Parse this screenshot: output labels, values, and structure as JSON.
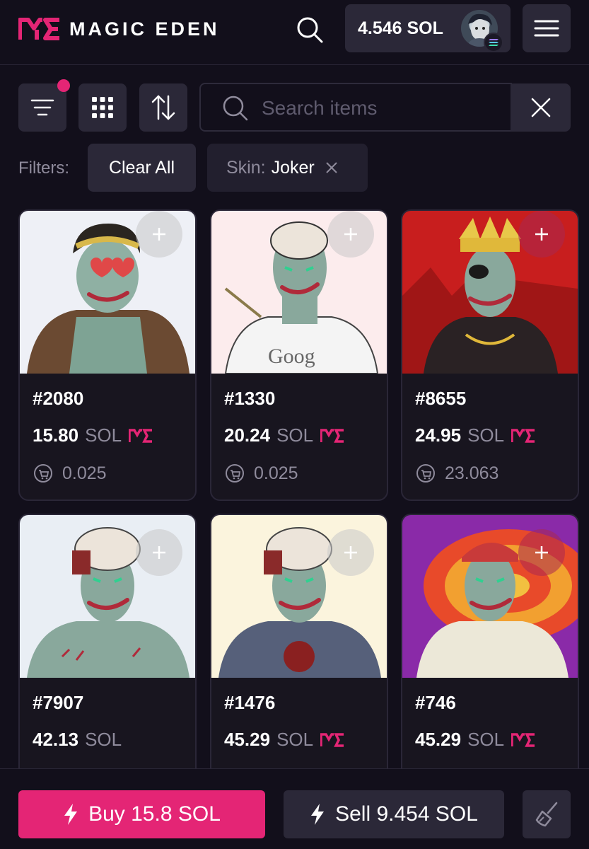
{
  "header": {
    "logo_text": "MAGIC EDEN",
    "wallet_balance": "4.546 SOL",
    "icons": [
      "magic-eden-logo-icon",
      "search-icon",
      "avatar",
      "solana-icon",
      "hamburger-menu-icon"
    ]
  },
  "toolbar": {
    "search_placeholder": "Search items",
    "icons": [
      "filter-icon",
      "grid-view-icon",
      "sort-icon",
      "search-icon",
      "close-icon"
    ]
  },
  "filters": {
    "label": "Filters:",
    "clear_all": "Clear All",
    "chip": {
      "key": "Skin:",
      "value": "Joker"
    }
  },
  "items": [
    {
      "name": "#2080",
      "price": "15.80",
      "currency": "SOL",
      "me_badge": true,
      "fee": "0.025"
    },
    {
      "name": "#1330",
      "price": "20.24",
      "currency": "SOL",
      "me_badge": true,
      "fee": "0.025"
    },
    {
      "name": "#8655",
      "price": "24.95",
      "currency": "SOL",
      "me_badge": true,
      "fee": "23.063"
    },
    {
      "name": "#7907",
      "price": "42.13",
      "currency": "SOL",
      "me_badge": false,
      "fee": ""
    },
    {
      "name": "#1476",
      "price": "45.29",
      "currency": "SOL",
      "me_badge": true,
      "fee": ""
    },
    {
      "name": "#746",
      "price": "45.29",
      "currency": "SOL",
      "me_badge": true,
      "fee": ""
    }
  ],
  "bottom": {
    "buy_label": "Buy 15.8 SOL",
    "sell_label": "Sell 9.454 SOL",
    "icons": [
      "lightning-icon",
      "broom-icon"
    ]
  },
  "colors": {
    "background": "#120f1b",
    "surface": "#2b2838",
    "accent": "#e42575",
    "muted_text": "#8f8b9c"
  }
}
